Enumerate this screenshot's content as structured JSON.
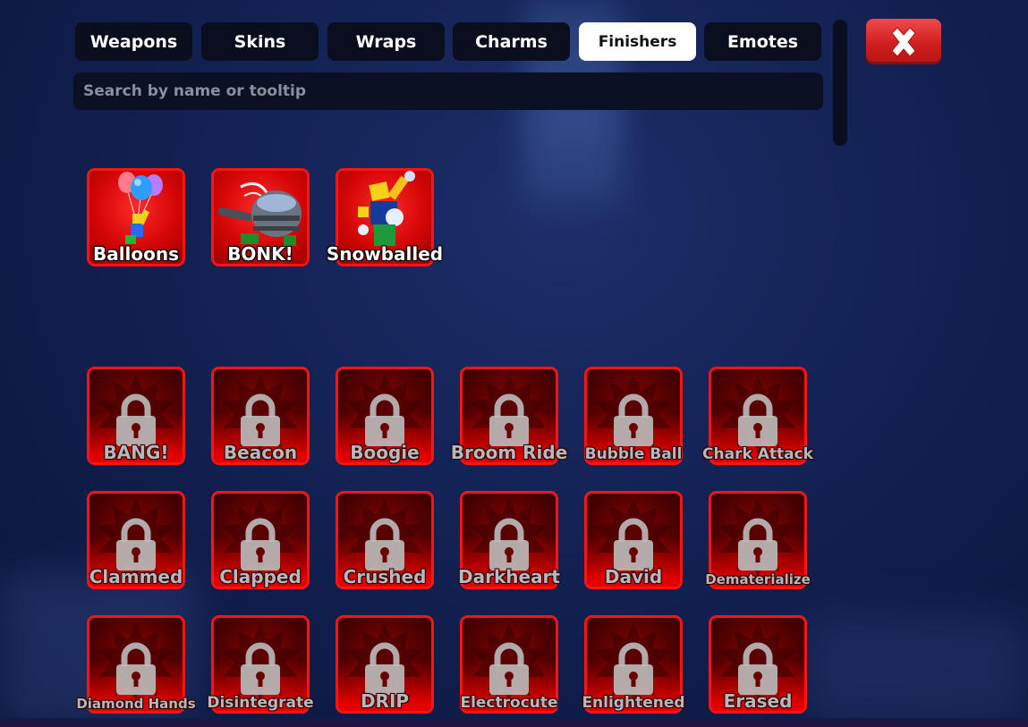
{
  "tabs": [
    {
      "label": "Weapons",
      "active": false
    },
    {
      "label": "Skins",
      "active": false
    },
    {
      "label": "Wraps",
      "active": false
    },
    {
      "label": "Charms",
      "active": false
    },
    {
      "label": "Finishers",
      "active": true
    },
    {
      "label": "Emotes",
      "active": false
    }
  ],
  "search": {
    "placeholder": "Search by name or tooltip"
  },
  "close_icon": "close-x-icon",
  "colors": {
    "accent_red": "#ff1414",
    "close_button": "#dd2a2a",
    "active_tab": "#ffffff"
  },
  "owned": [
    {
      "name": "Balloons",
      "icon": "balloons-icon"
    },
    {
      "name": "BONK!",
      "icon": "bonk-icon"
    },
    {
      "name": "Snowballed",
      "icon": "snowballed-icon"
    }
  ],
  "locked": [
    {
      "name": "BANG!"
    },
    {
      "name": "Beacon"
    },
    {
      "name": "Boogie"
    },
    {
      "name": "Broom Ride"
    },
    {
      "name": "Bubble Ball"
    },
    {
      "name": "Chark Attack"
    },
    {
      "name": "Clammed"
    },
    {
      "name": "Clapped"
    },
    {
      "name": "Crushed"
    },
    {
      "name": "Darkheart"
    },
    {
      "name": "David"
    },
    {
      "name": "Dematerialize"
    },
    {
      "name": "Diamond Hands"
    },
    {
      "name": "Disintegrate"
    },
    {
      "name": "DRIP"
    },
    {
      "name": "Electrocute"
    },
    {
      "name": "Enlightened"
    },
    {
      "name": "Erased"
    }
  ]
}
